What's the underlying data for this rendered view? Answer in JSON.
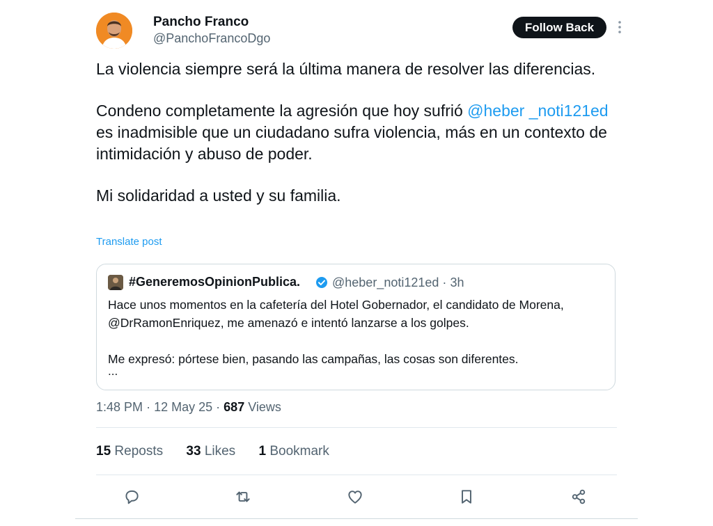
{
  "author": {
    "name": "Pancho Franco",
    "handle": "@PanchoFrancoDgo",
    "follow_label": "Follow Back",
    "avatar_icon": "profile-photo",
    "more_icon": "more-vertical-icon"
  },
  "post": {
    "p1": "La violencia siempre será la última manera de resolver las diferencias.",
    "p2_before": "Condeno completamente la agresión que hoy sufrió ",
    "p2_mention": "@heber _noti121ed",
    "p2_after": "  es inadmisible que un ciudadano sufra violencia, más en un contexto de intimidación y abuso de poder.",
    "p3": "Mi solidaridad a usted y su familia.",
    "translate_label": "Translate post",
    "mention_color": "#1d9bf0"
  },
  "quote": {
    "name": "#GeneremosOpinionPublica.",
    "handle": "@heber_noti121ed",
    "time": "3h",
    "verified_icon": "verified-badge-icon",
    "text_p1": "Hace unos momentos en la cafetería del Hotel Gobernador, el candidato de Morena, @DrRamonEnriquez, me amenazó e intentó lanzarse a los golpes.",
    "text_p2": "Me expresó: pórtese bien, pasando las campañas, las cosas son diferentes.",
    "ellipsis": "..."
  },
  "meta": {
    "time": "1:48 PM",
    "date": "12 May 25",
    "views_count": "687",
    "views_label": "Views"
  },
  "stats": {
    "reposts_count": "15",
    "reposts_label": "Reposts",
    "likes_count": "33",
    "likes_label": "Likes",
    "bookmarks_count": "1",
    "bookmarks_label": "Bookmark"
  },
  "actions": [
    "reply-icon",
    "repost-icon",
    "like-icon",
    "bookmark-icon",
    "share-icon"
  ]
}
